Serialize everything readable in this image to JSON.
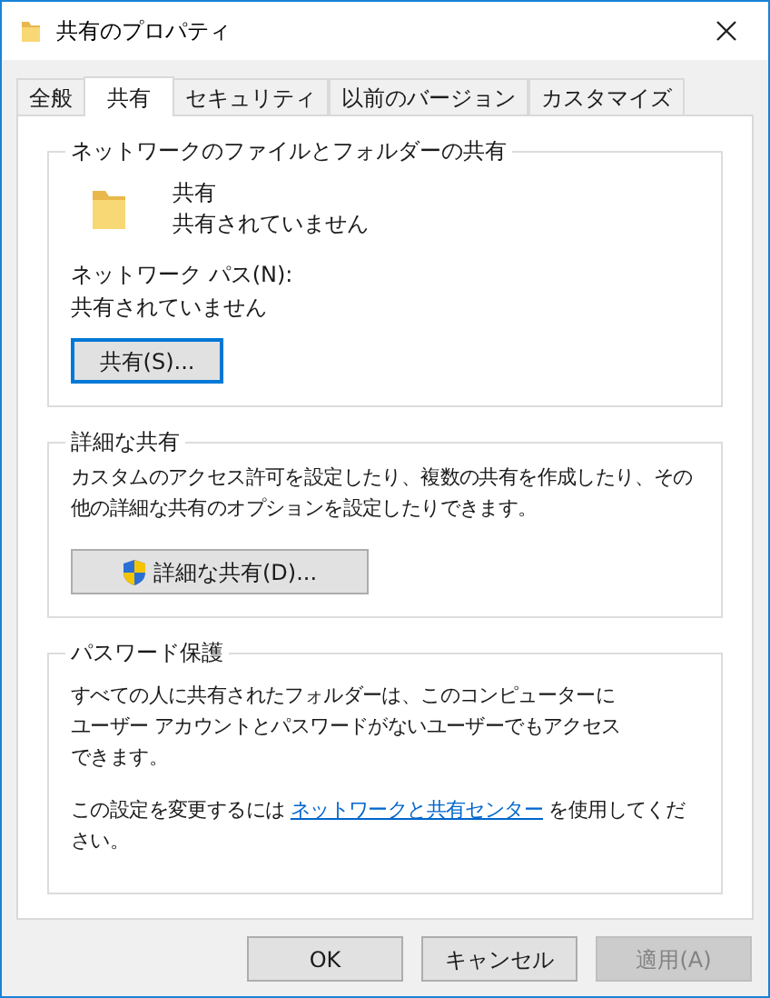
{
  "window": {
    "title": "共有のプロパティ"
  },
  "tabs": [
    {
      "label": "全般",
      "selected": false
    },
    {
      "label": "共有",
      "selected": true
    },
    {
      "label": "セキュリティ",
      "selected": false
    },
    {
      "label": "以前のバージョン",
      "selected": false
    },
    {
      "label": "カスタマイズ",
      "selected": false
    }
  ],
  "network_sharing": {
    "title": "ネットワークのファイルとフォルダーの共有",
    "folder_name": "共有",
    "folder_status": "共有されていません",
    "path_label": "ネットワーク パス(N):",
    "path_value": "共有されていません",
    "share_button": {
      "label": "共有(S)...",
      "focused": true
    }
  },
  "advanced_sharing": {
    "title": "詳細な共有",
    "description": "カスタムのアクセス許可を設定したり、複数の共有を作成したり、その他の詳細な共有のオプションを設定したりできます。",
    "button": {
      "label": "詳細な共有(D)...",
      "focused": false
    }
  },
  "password_protection": {
    "title": "パスワード保護",
    "description": "すべての人に共有されたフォルダーは、このコンピューターにユーザー アカウントとパスワードがないユーザーでもアクセスできます。",
    "note_before": "この設定を変更するには",
    "link": "ネットワークと共有センター",
    "note_after": "を使用してください。"
  },
  "buttons": [
    {
      "label": "OK",
      "disabled": false
    },
    {
      "label": "キャンセル",
      "disabled": false
    },
    {
      "label": "適用(A)",
      "disabled": true
    }
  ]
}
